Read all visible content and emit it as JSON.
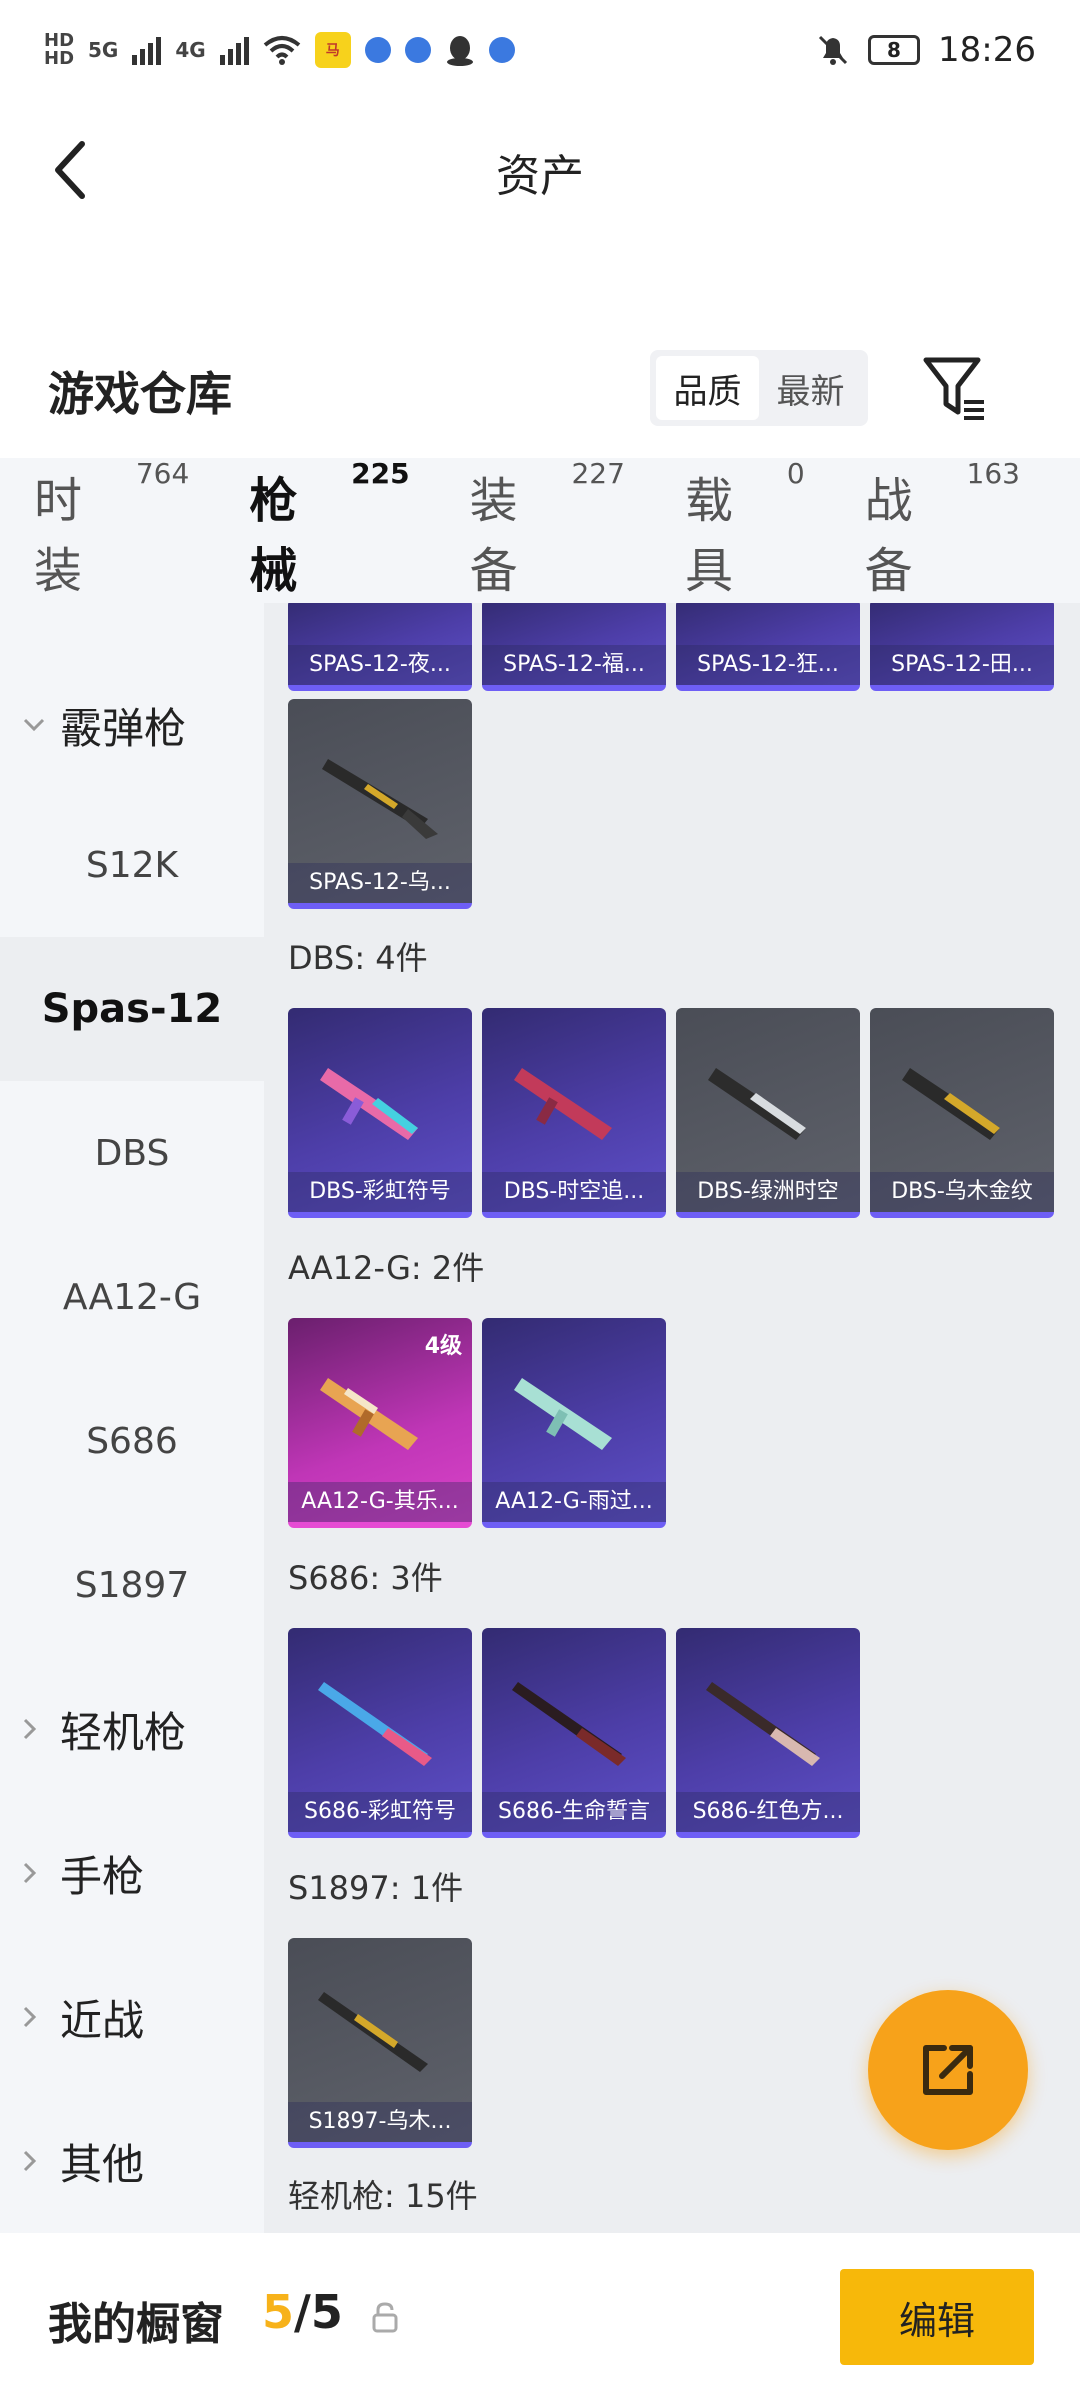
{
  "status_bar": {
    "time": "18:26",
    "battery": "8",
    "network_5g": "5G",
    "network_4g": "4G",
    "hd1": "HD",
    "hd2": "HD"
  },
  "header": {
    "title": "资产"
  },
  "warehouse": {
    "title": "游戏仓库",
    "sort_options": [
      "品质",
      "最新"
    ],
    "active_sort": "品质"
  },
  "tabs": [
    {
      "label": "时装",
      "count": "764"
    },
    {
      "label": "枪械",
      "count": "225",
      "active": true
    },
    {
      "label": "装备",
      "count": "227"
    },
    {
      "label": "载具",
      "count": "0"
    },
    {
      "label": "战备",
      "count": "163"
    }
  ],
  "sidebar": {
    "group_shotgun": "霰弹枪",
    "items": [
      "S12K",
      "Spas-12",
      "DBS",
      "AA12-G",
      "S686",
      "S1897"
    ],
    "active_item": "Spas-12",
    "group_lmg": "轻机枪",
    "group_pistol": "手枪",
    "group_melee": "近战",
    "group_other": "其他"
  },
  "content": {
    "spas_top_row": [
      "SPAS-12-夜...",
      "SPAS-12-福...",
      "SPAS-12-狂...",
      "SPAS-12-田..."
    ],
    "spas_last": "SPAS-12-乌...",
    "dbs_title": "DBS: 4件",
    "dbs_items": [
      "DBS-彩虹符号",
      "DBS-时空追...",
      "DBS-绿洲时空",
      "DBS-乌木金纹"
    ],
    "aa12_title": "AA12-G: 2件",
    "aa12_items": [
      "AA12-G-其乐...",
      "AA12-G-雨过..."
    ],
    "aa12_level": "4级",
    "s686_title": "S686: 3件",
    "s686_items": [
      "S686-彩虹符号",
      "S686-生命誓言",
      "S686-红色方..."
    ],
    "s1897_title": "S1897: 1件",
    "s1897_items": [
      "S1897-乌木..."
    ],
    "lmg_title": "轻机枪: 15件"
  },
  "bottom": {
    "window_label": "我的橱窗",
    "current": "5",
    "separator": "/",
    "total": "5",
    "edit_label": "编辑"
  },
  "colors": {
    "accent": "#f7b21a",
    "card_purple": "#4d3ea8",
    "card_gray": "#5f626b",
    "card_pink": "#c036b7"
  }
}
